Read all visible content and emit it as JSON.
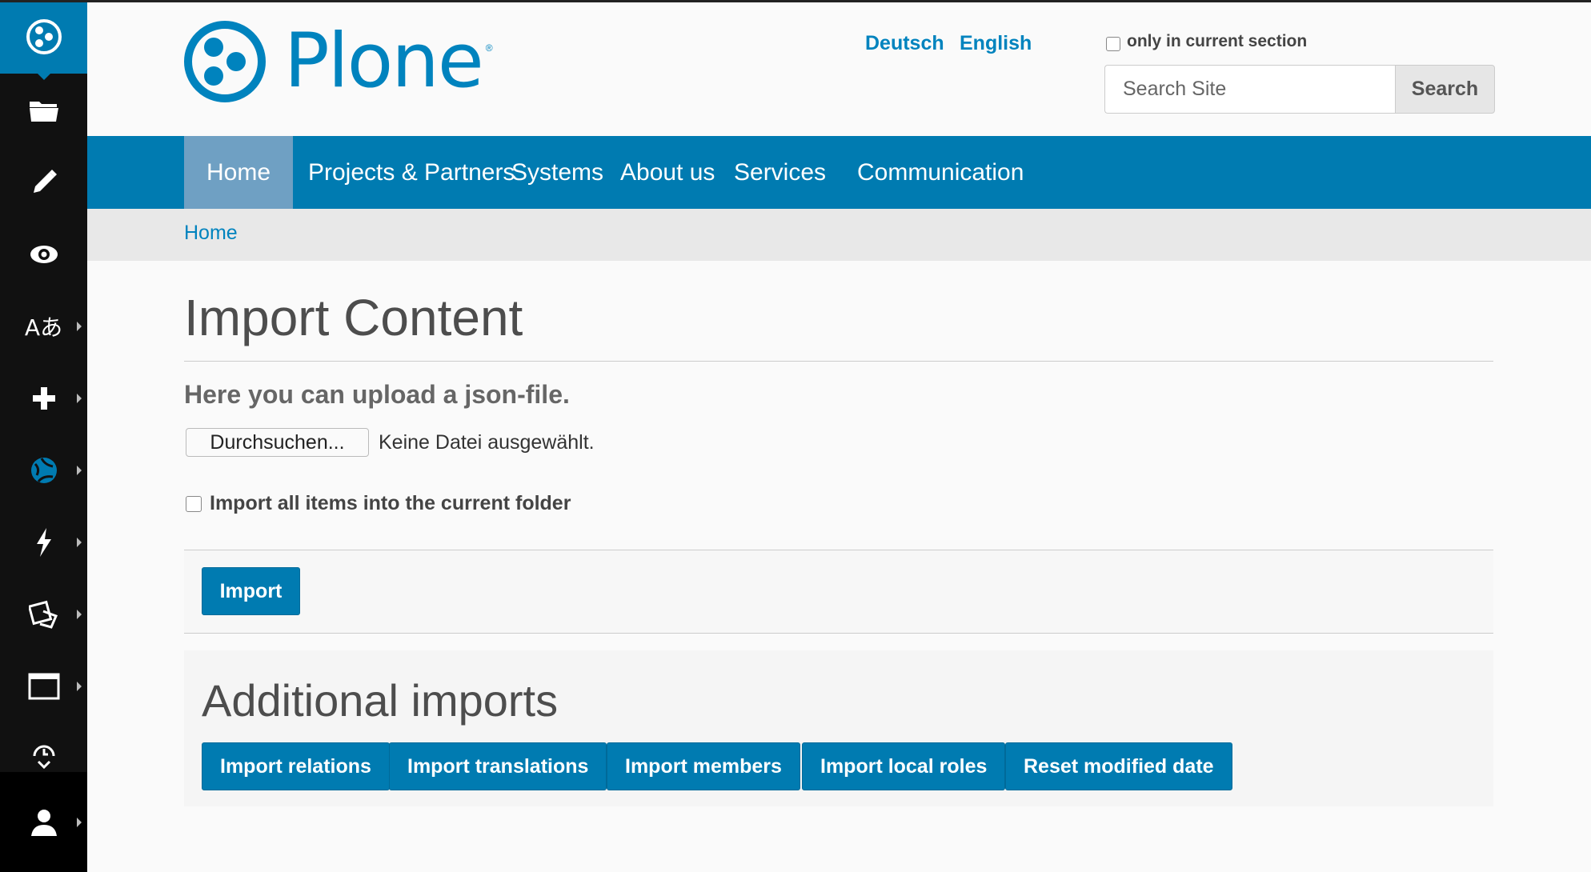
{
  "toolbar": {
    "items": [
      {
        "icon": "folder-icon",
        "has_submenu": false
      },
      {
        "icon": "pencil-icon",
        "has_submenu": false
      },
      {
        "icon": "eye-icon",
        "has_submenu": false
      },
      {
        "icon": "translate-icon",
        "has_submenu": true
      },
      {
        "icon": "plus-icon",
        "has_submenu": true
      },
      {
        "icon": "globe-icon",
        "has_submenu": true
      },
      {
        "icon": "lightning-icon",
        "has_submenu": true
      },
      {
        "icon": "display-icon",
        "has_submenu": true
      },
      {
        "icon": "window-icon",
        "has_submenu": true
      },
      {
        "icon": "clock-icon",
        "has_submenu": false
      }
    ]
  },
  "header": {
    "logo_text": "Plone",
    "logo_mark": "®",
    "languages": [
      "Deutsch",
      "English"
    ],
    "search": {
      "only_current_section_label": "only in current section",
      "placeholder": "Search Site",
      "button_label": "Search"
    }
  },
  "nav": {
    "items": [
      "Home",
      "Projects & Partners",
      "Systems",
      "About us",
      "Services",
      "Communication"
    ],
    "active": "Home"
  },
  "breadcrumb": [
    "Home"
  ],
  "main": {
    "title": "Import Content",
    "lead": "Here you can upload a json-file.",
    "file_button_label": "Durchsuchen...",
    "file_status": "Keine Datei ausgewählt.",
    "folder_checkbox_label": "Import all items into the current folder",
    "import_button_label": "Import"
  },
  "additional": {
    "title": "Additional imports",
    "buttons": [
      "Import relations",
      "Import translations",
      "Import members",
      "Import local roles",
      "Reset modified date"
    ]
  },
  "colors": {
    "brand": "#007bb1",
    "toolbar_bg": "#111111",
    "nav_active": "#6fa0c3",
    "breadcrumb_bg": "#e8e8e8"
  }
}
